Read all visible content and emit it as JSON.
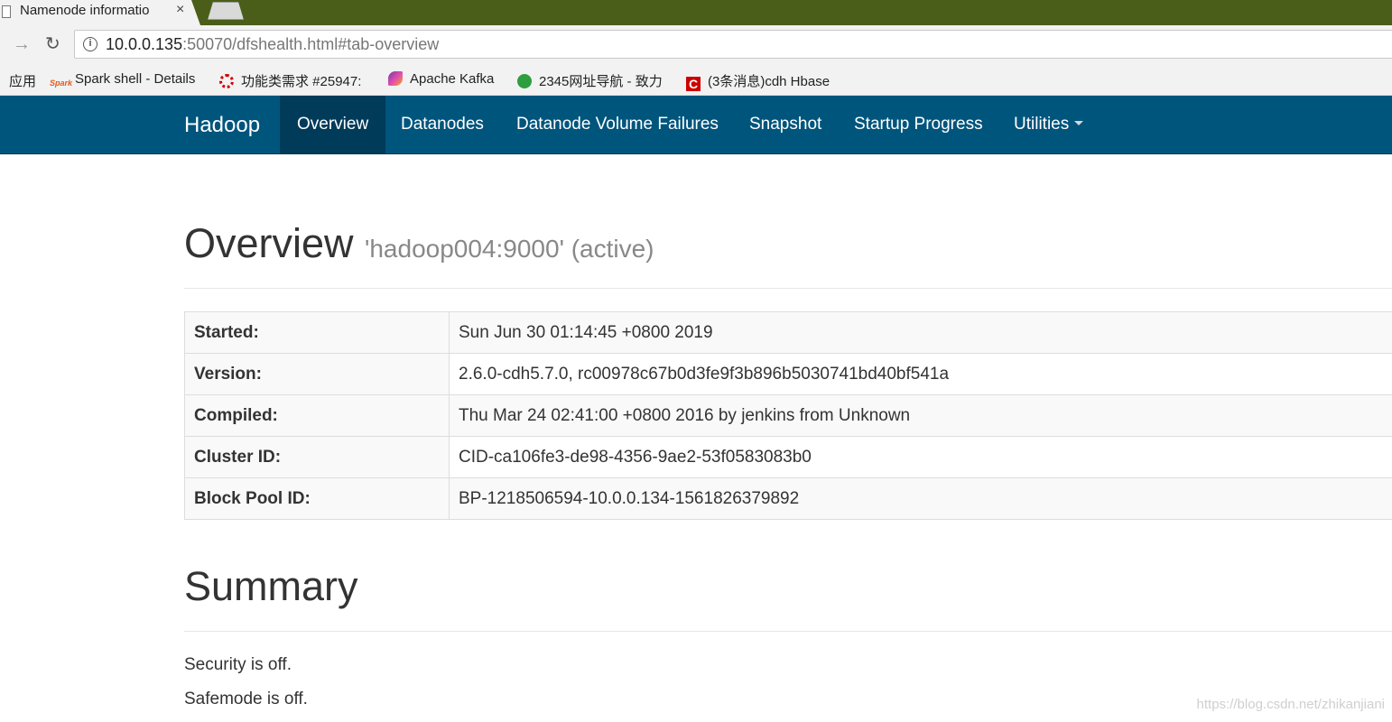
{
  "browser": {
    "tab_title": "Namenode informatio",
    "tab_close": "×",
    "url_host": "10.0.0.135",
    "url_rest": ":50070/dfshealth.html#tab-overview",
    "bookmarks": [
      {
        "label": "应用",
        "icon": "apps-icon"
      },
      {
        "label": "Spark shell - Details",
        "icon": "spark-icon"
      },
      {
        "label": "功能类需求 #25947:",
        "icon": "redhat-icon"
      },
      {
        "label": "Apache Kafka",
        "icon": "kafka-icon"
      },
      {
        "label": "2345网址导航 - 致力",
        "icon": "2345-icon"
      },
      {
        "label": "(3条消息)cdh Hbase",
        "icon": "csdn-icon"
      }
    ]
  },
  "navbar": {
    "brand": "Hadoop",
    "items": [
      "Overview",
      "Datanodes",
      "Datanode Volume Failures",
      "Snapshot",
      "Startup Progress",
      "Utilities"
    ],
    "active": "Overview",
    "colors": {
      "bar": "#00557d",
      "active": "#003b5a"
    }
  },
  "overview": {
    "title": "Overview",
    "subtitle": "'hadoop004:9000' (active)",
    "rows": [
      {
        "key": "Started:",
        "value": "Sun Jun 30 01:14:45 +0800 2019"
      },
      {
        "key": "Version:",
        "value": "2.6.0-cdh5.7.0, rc00978c67b0d3fe9f3b896b5030741bd40bf541a"
      },
      {
        "key": "Compiled:",
        "value": "Thu Mar 24 02:41:00 +0800 2016 by jenkins from Unknown"
      },
      {
        "key": "Cluster ID:",
        "value": "CID-ca106fe3-de98-4356-9ae2-53f0583083b0"
      },
      {
        "key": "Block Pool ID:",
        "value": "BP-1218506594-10.0.0.134-1561826379892"
      }
    ]
  },
  "summary": {
    "title": "Summary",
    "security": "Security is off.",
    "safemode": "Safemode is off."
  },
  "watermark": "https://blog.csdn.net/zhikanjiani"
}
